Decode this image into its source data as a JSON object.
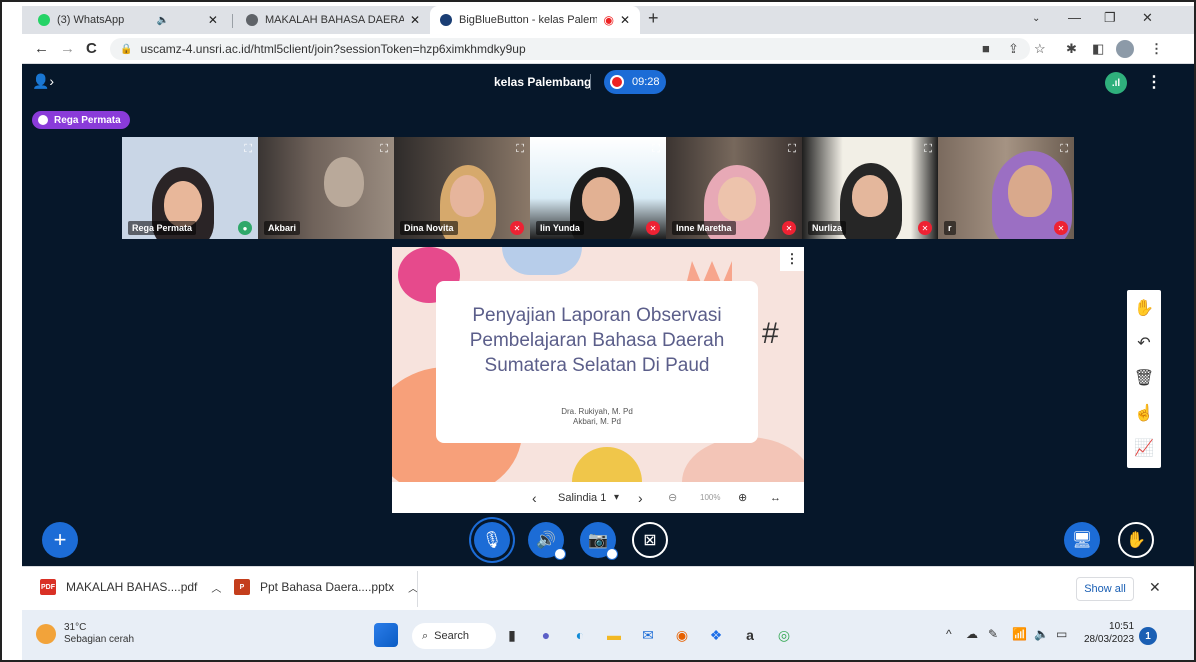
{
  "browser": {
    "tabs": [
      {
        "title": "(3) WhatsApp",
        "active": false
      },
      {
        "title": "MAKALAH BAHASA DAERAH KEL",
        "active": false
      },
      {
        "title": "BigBlueButton - kelas Palemb",
        "active": true
      }
    ],
    "url": "uscamz-4.unsri.ac.id/html5client/join?sessionToken=hzp6ximkhmdky9up"
  },
  "meeting": {
    "title": "kelas Palembang",
    "recording_time": "09:28",
    "talking_user": "Rega Permata",
    "participants": [
      {
        "name": "Rega Permata",
        "speaking": true
      },
      {
        "name": "Akbari",
        "speaking": false
      },
      {
        "name": "Dina Novita",
        "speaking": false
      },
      {
        "name": "Iin Yunda",
        "speaking": false
      },
      {
        "name": "Inne Maretha",
        "speaking": false
      },
      {
        "name": "Nurliza",
        "speaking": false
      },
      {
        "name": "r",
        "speaking": false
      }
    ]
  },
  "presentation": {
    "title": "Penyajian Laporan Observasi Pembelajaran Bahasa Daerah Sumatera Selatan Di Paud",
    "author1": "Dra. Rukiyah, M. Pd",
    "author2": "Akbari, M. Pd",
    "slide_label": "Salindia 1",
    "zoom": "100%"
  },
  "downloads": {
    "items": [
      {
        "name": "MAKALAH BAHAS....pdf",
        "type": "pdf"
      },
      {
        "name": "Ppt Bahasa Daera....pptx",
        "type": "pptx"
      }
    ],
    "show_all": "Show all"
  },
  "taskbar": {
    "temperature": "31°C",
    "weather": "Sebagian cerah",
    "search_label": "Search",
    "time": "10:51",
    "date": "28/03/2023",
    "notifications": "1"
  },
  "colors": {
    "bbb_bg": "#06172a",
    "accent": "#1c6cd6",
    "talker": "#8a3bd9"
  }
}
